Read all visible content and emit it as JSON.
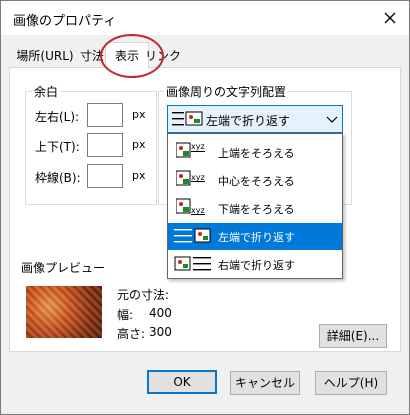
{
  "window": {
    "title": "画像のプロパティ",
    "close_label": "✕"
  },
  "tabs": [
    {
      "label": "場所(URL)"
    },
    {
      "label": "寸法"
    },
    {
      "label": "表示"
    },
    {
      "label": "リンク"
    }
  ],
  "active_tab": "表示",
  "margin_group": {
    "title": "余白",
    "fields": [
      {
        "label": "左右(L):",
        "value": "",
        "unit": "px"
      },
      {
        "label": "上下(T):",
        "value": "",
        "unit": "px"
      },
      {
        "label": "枠線(B):",
        "value": "",
        "unit": "px"
      }
    ]
  },
  "wrap_group": {
    "title": "画像周りの文字列配置",
    "selected": "左端で折り返す",
    "options": [
      {
        "label": "上端をそろえる",
        "icon": "align-top-icon",
        "selected": false
      },
      {
        "label": "中心をそろえる",
        "icon": "align-center-icon",
        "selected": false
      },
      {
        "label": "下端をそろえる",
        "icon": "align-bottom-icon",
        "selected": false
      },
      {
        "label": "左端で折り返す",
        "icon": "wrap-left-icon",
        "selected": true
      },
      {
        "label": "右端で折り返す",
        "icon": "wrap-right-icon",
        "selected": false
      }
    ]
  },
  "preview": {
    "title": "画像プレビュー",
    "original_size_label": "元の寸法:",
    "width_label": "幅:",
    "width_value": "400",
    "height_label": "高さ:",
    "height_value": "300"
  },
  "buttons": {
    "details": "詳細(E)...",
    "ok": "OK",
    "cancel": "キャンセル",
    "help": "ヘルプ(H)"
  },
  "colors": {
    "accent": "#0078d7",
    "annotation": "#c0282d"
  }
}
